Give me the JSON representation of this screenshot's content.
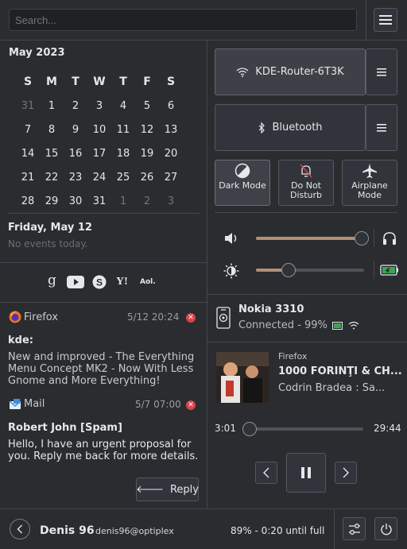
{
  "search": {
    "placeholder": "Search..."
  },
  "calendar": {
    "month": "May 2023",
    "weekdays": [
      "S",
      "M",
      "T",
      "W",
      "T",
      "F",
      "S"
    ],
    "weeks": [
      [
        "31",
        "1",
        "2",
        "3",
        "4",
        "5",
        "6"
      ],
      [
        "7",
        "8",
        "9",
        "10",
        "11",
        "12",
        "13"
      ],
      [
        "14",
        "15",
        "16",
        "17",
        "18",
        "19",
        "20"
      ],
      [
        "21",
        "22",
        "23",
        "24",
        "25",
        "26",
        "27"
      ],
      [
        "28",
        "29",
        "30",
        "31",
        "1",
        "2",
        "3"
      ]
    ],
    "selected_date": "Friday, May 12",
    "no_events": "No events today."
  },
  "social": {
    "google": "g",
    "yahoo": "Y!",
    "aol": "Aol."
  },
  "notifications": [
    {
      "app": "Firefox",
      "time": "5/12 20:24",
      "title": "kde:",
      "body": "New and improved - The Everything Menu Concept MK2 - Now With Less Gnome and More Everything!"
    },
    {
      "app": "Mail",
      "time": "5/7 07:00",
      "title": "Robert John [Spam]",
      "body": "Hello, I have an urgent proposal for you. Reply me back for more details.",
      "action": "Reply"
    }
  ],
  "network": {
    "wifi": "KDE-Router-6T3K",
    "bluetooth": "Bluetooth"
  },
  "toggles": [
    {
      "label": "Dark Mode",
      "icon": "dark-mode-icon",
      "active": true
    },
    {
      "label": "Do Not Disturb",
      "icon": "bell-off-icon",
      "active": false
    },
    {
      "label": "Airplane Mode",
      "icon": "airplane-icon",
      "active": false
    }
  ],
  "sliders": {
    "volume": 0.98,
    "brightness": 0.3
  },
  "device": {
    "name": "Nokia 3310",
    "status": "Connected - 99%"
  },
  "media": {
    "app": "Firefox",
    "title": "1000 FORINŢI & CH...",
    "artist": "Codrin Bradea : Sa...",
    "elapsed": "3:01",
    "duration": "29:44",
    "progress": 0.0
  },
  "footer": {
    "user": "Denis 96",
    "email": "denis96@optiplex",
    "battery": "89% - 0:20 until full"
  },
  "colors": {
    "accent": "#b08f77",
    "close": "#d7454a",
    "bg": "#2a2c30"
  }
}
